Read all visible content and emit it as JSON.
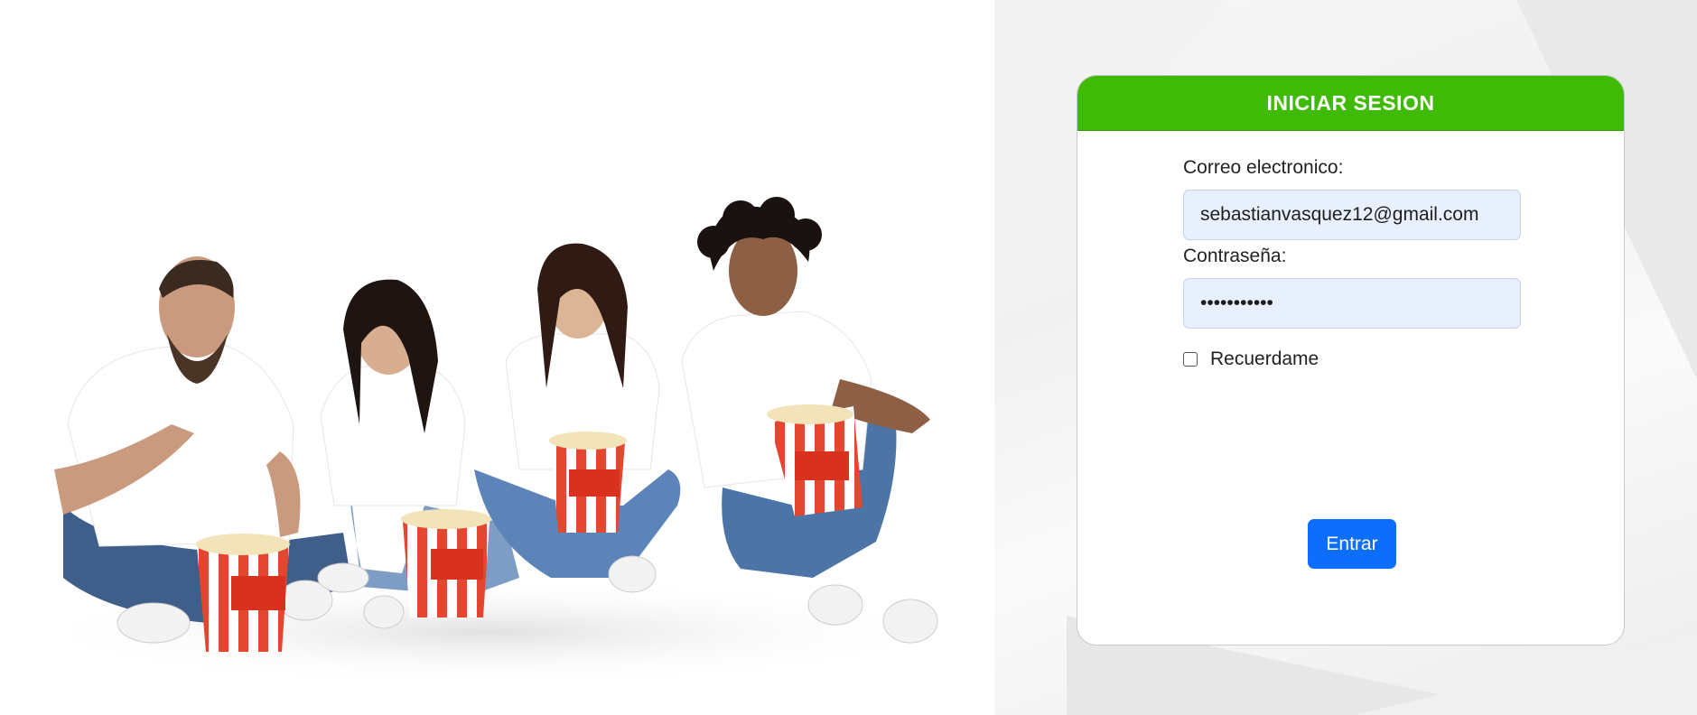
{
  "hero": {
    "image": "people-eating-popcorn-photo",
    "colors": {
      "shirt": "#ffffff",
      "jeans": "#4a6d99",
      "popcorn_stripe": "#e4472f",
      "skin": "#c99a7d"
    }
  },
  "login": {
    "title": "INICIAR SESION",
    "email_label": "Correo electronico:",
    "email_value": "sebastianvasquez12@gmail.com",
    "password_label": "Contraseña:",
    "password_value": "secretpass1",
    "remember_label": "Recuerdame",
    "remember_checked": false,
    "submit_label": "Entrar"
  },
  "colors": {
    "header_green": "#3fba06",
    "button_blue": "#0d6efd",
    "input_bg": "#e8f0fe"
  }
}
